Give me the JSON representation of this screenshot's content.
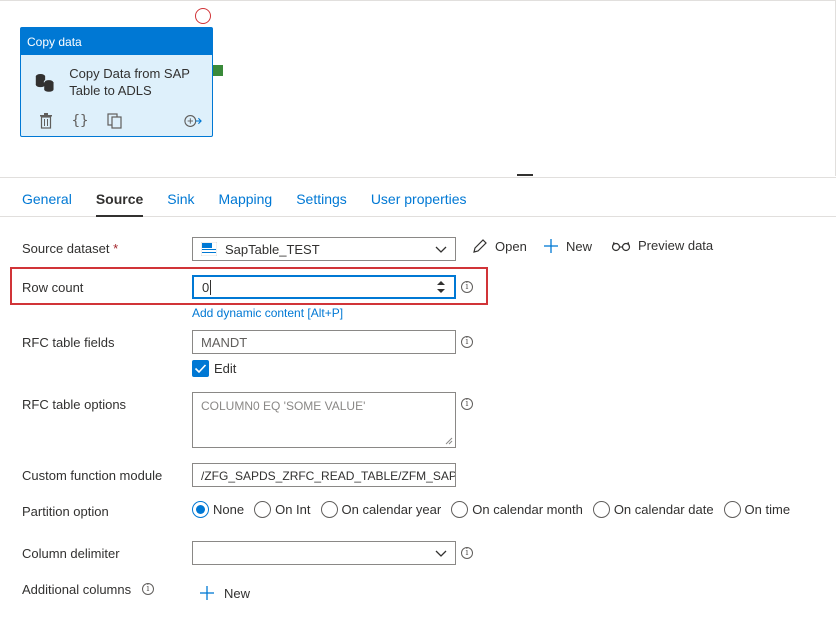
{
  "activity": {
    "header": "Copy data",
    "name": "Copy Data from SAP Table to ADLS"
  },
  "tabs": [
    {
      "label": "General"
    },
    {
      "label": "Source"
    },
    {
      "label": "Sink"
    },
    {
      "label": "Mapping"
    },
    {
      "label": "Settings"
    },
    {
      "label": "User properties"
    }
  ],
  "source_dataset": {
    "label": "Source dataset",
    "required_mark": "*",
    "value": "SapTable_TEST",
    "icon_text": "SAP\nTable",
    "open_label": "Open",
    "new_label": "New",
    "preview_label": "Preview data"
  },
  "row_count": {
    "label": "Row count",
    "value": "0",
    "dynamic_link": "Add dynamic content [Alt+P]"
  },
  "rfc_table_fields": {
    "label": "RFC table fields",
    "value": "MANDT",
    "edit_label": "Edit",
    "edit_checked": true
  },
  "rfc_table_options": {
    "label": "RFC table options",
    "placeholder": "COLUMN0 EQ 'SOME VALUE'"
  },
  "custom_function_module": {
    "label": "Custom function module",
    "value": "/ZFG_SAPDS_ZRFC_READ_TABLE/ZFM_SAPDS"
  },
  "partition_option": {
    "label": "Partition option",
    "options": [
      "None",
      "On Int",
      "On calendar year",
      "On calendar month",
      "On calendar date",
      "On time"
    ],
    "selected": "None"
  },
  "column_delimiter": {
    "label": "Column delimiter",
    "value": ""
  },
  "additional_columns": {
    "label": "Additional columns",
    "new_label": "New"
  },
  "info_glyph": "i",
  "colors": {
    "accent": "#0078d4",
    "highlight": "#d13438",
    "port": "#3a8a3a"
  }
}
